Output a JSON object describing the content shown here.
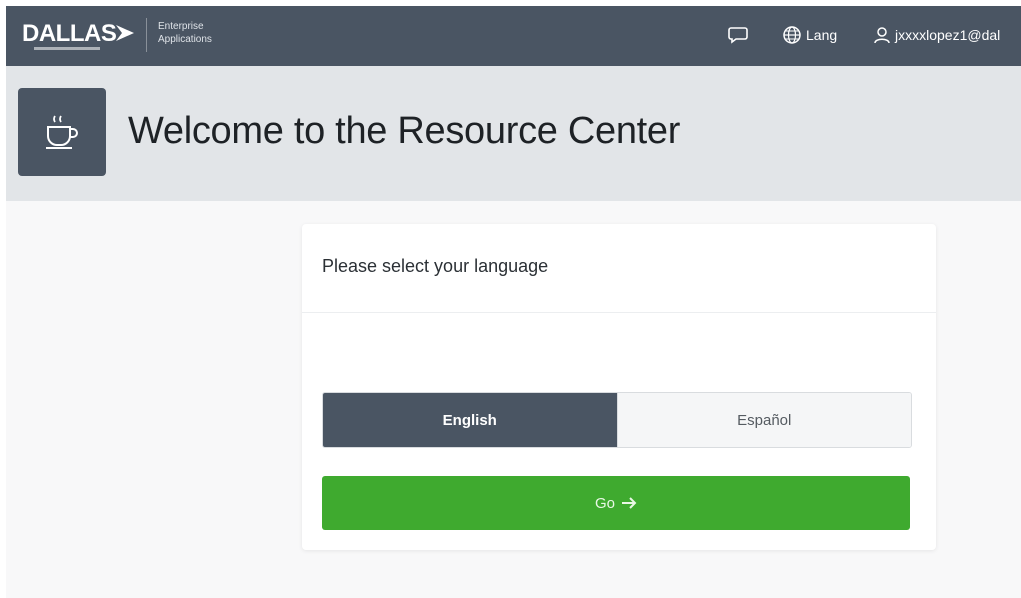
{
  "nav": {
    "logo_text": "DALLAS",
    "tagline": "Enterprise Applications",
    "lang_label": "Lang",
    "user_label": "jxxxxlopez1@dal"
  },
  "header": {
    "title": "Welcome to the Resource Center",
    "icon": "coffee-cup-icon"
  },
  "card": {
    "prompt": "Please select your language",
    "languages": [
      {
        "label": "English",
        "selected": true
      },
      {
        "label": "Español",
        "selected": false
      }
    ],
    "go_label": "Go"
  },
  "icons": {
    "chat": "chat-icon",
    "globe": "globe-icon",
    "user": "user-icon",
    "arrow": "arrow-right-icon"
  },
  "colors": {
    "nav_bg": "#4a5563",
    "header_band": "#e2e5e8",
    "selected_lang": "#4a5563",
    "go_button": "#3faa2f"
  }
}
